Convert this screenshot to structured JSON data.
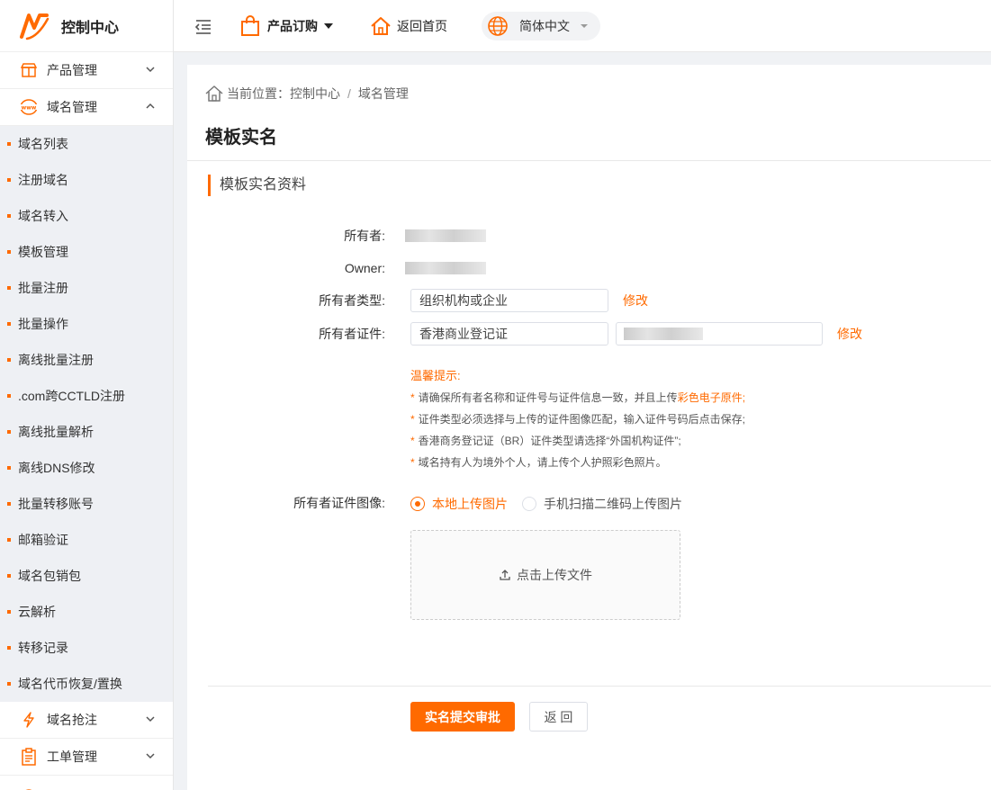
{
  "app": {
    "title": "控制中心"
  },
  "sidebar": {
    "groups_top": [
      {
        "label": "产品管理",
        "icon": "product-box-icon",
        "expanded": false
      },
      {
        "label": "域名管理",
        "icon": "www-icon",
        "expanded": true
      }
    ],
    "sub_items": [
      "域名列表",
      "注册域名",
      "域名转入",
      "模板管理",
      "批量注册",
      "批量操作",
      "离线批量注册",
      ".com跨CCTLD注册",
      "离线批量解析",
      "离线DNS修改",
      "批量转移账号",
      "邮箱验证",
      "域名包销包",
      "云解析",
      "转移记录",
      "域名代币恢复/置换"
    ],
    "groups_bottom": [
      {
        "label": "域名抢注",
        "icon": "lightning-icon",
        "expanded": false
      },
      {
        "label": "工单管理",
        "icon": "clipboard-icon",
        "expanded": false
      },
      {
        "label": "",
        "icon": "partial-icon",
        "expanded": false
      }
    ]
  },
  "topbar": {
    "order_label": "产品订购",
    "home_label": "返回首页",
    "language": "简体中文"
  },
  "breadcrumb": {
    "prefix": "当前位置：",
    "items": [
      "控制中心",
      "域名管理"
    ],
    "separator": "/"
  },
  "page": {
    "title": "模板实名",
    "section_title": "模板实名资料"
  },
  "form": {
    "owner_label": "所有者",
    "owner_en_label": "Owner",
    "owner_type_label": "所有者类型",
    "owner_type_value": "组织机构或企业",
    "owner_cert_label": "所有者证件",
    "owner_cert_type_value": "香港商业登记证",
    "edit_label": "修改",
    "colon": ":"
  },
  "tips": {
    "title": "温馨提示:",
    "line1_pre": "请确保所有者名称和证件号与证件信息一致，并且上传",
    "line1_hl": "彩色电子原件;",
    "line2": "证件类型必须选择与上传的证件图像匹配，输入证件号码后点击保存;",
    "line3": "香港商务登记证（BR）证件类型请选择“外国机构证件”;",
    "line4": "域名持有人为境外个人，请上传个人护照彩色照片。"
  },
  "upload": {
    "label": "所有者证件图像",
    "option_local": "本地上传图片",
    "option_mobile": "手机扫描二维码上传图片",
    "selected": "本地上传图片",
    "button_label": "点击上传文件"
  },
  "actions": {
    "submit_label": "实名提交审批",
    "back_label": "返 回"
  },
  "colors": {
    "accent": "#ff6a00",
    "sidebar_sub_bg": "#eef0f4",
    "page_bg": "#f0f2f5"
  }
}
